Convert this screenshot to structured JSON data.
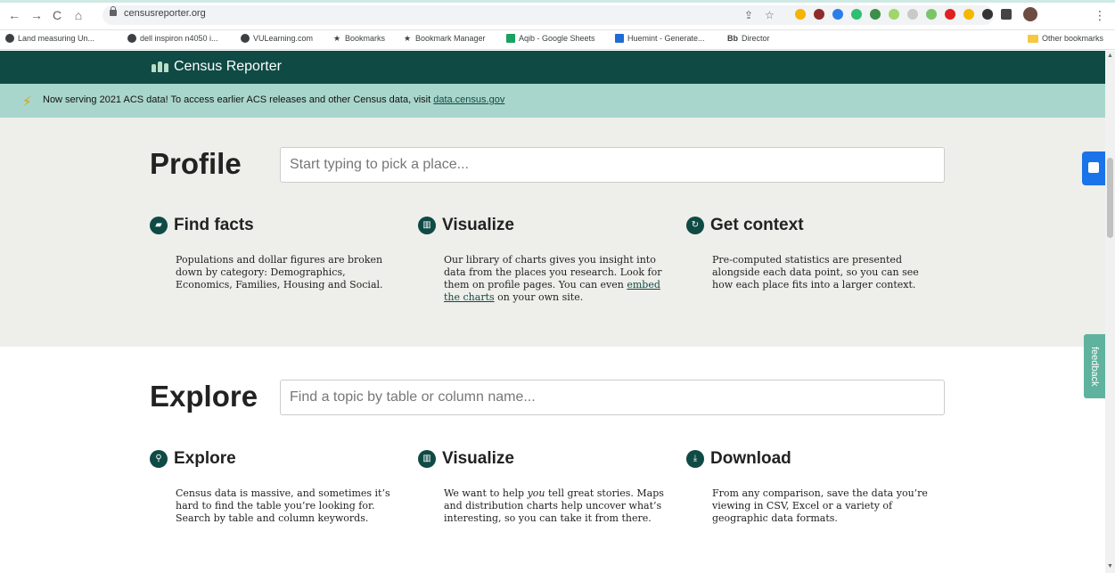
{
  "browser": {
    "url": "censusreporter.org",
    "bookmarks": [
      {
        "label": "Land measuring Un...",
        "icon": "globe-icon"
      },
      {
        "label": "dell inspiron n4050 i...",
        "icon": "globe-icon"
      },
      {
        "label": "VULearning.com",
        "icon": "globe-icon"
      },
      {
        "label": "Bookmarks",
        "icon": "star-icon"
      },
      {
        "label": "Bookmark Manager",
        "icon": "star-icon"
      },
      {
        "label": "Aqib - Google Sheets",
        "icon": "sheets-icon"
      },
      {
        "label": "Huemint - Generate...",
        "icon": "huemint-icon"
      },
      {
        "label": "Director",
        "icon": "bb-icon",
        "prefix": "Bb"
      }
    ],
    "other_bookmarks": "Other bookmarks"
  },
  "site": {
    "name": "Census Reporter"
  },
  "notice": {
    "text": "Now serving 2021 ACS data! To access earlier ACS releases and other Census data, visit ",
    "link": "data.census.gov"
  },
  "profile": {
    "title": "Profile",
    "placeholder": "Start typing to pick a place...",
    "features": [
      {
        "title": "Find facts",
        "icon": "book-icon",
        "desc": "Populations and dollar figures are broken down by category: Demographics, Economics, Families, Housing and Social."
      },
      {
        "title": "Visualize",
        "icon": "bar-chart-icon",
        "desc_before": "Our library of charts gives you insight into data from the places you research. Look for them on profile pages. You can even ",
        "desc_link": "embed the charts",
        "desc_after": " on your own site."
      },
      {
        "title": "Get context",
        "icon": "refresh-icon",
        "desc": "Pre-computed statistics are presented alongside each data point, so you can see how each place fits into a larger context."
      }
    ]
  },
  "explore": {
    "title": "Explore",
    "placeholder": "Find a topic by table or column name...",
    "features": [
      {
        "title": "Explore",
        "icon": "search-icon",
        "desc": "Census data is massive, and sometimes it’s hard to find the table you’re looking for. Search by table and column keywords."
      },
      {
        "title": "Visualize",
        "icon": "bar-chart-icon",
        "desc_before": "We want to help ",
        "desc_em": "you",
        "desc_after": " tell great stories. Maps and distribution charts help uncover what’s interesting, so you can take it from there."
      },
      {
        "title": "Download",
        "icon": "download-icon",
        "desc": "From any comparison, save the data you’re viewing in CSV, Excel or a variety of geographic data formats."
      }
    ]
  },
  "feedback": {
    "label": "feedback"
  }
}
